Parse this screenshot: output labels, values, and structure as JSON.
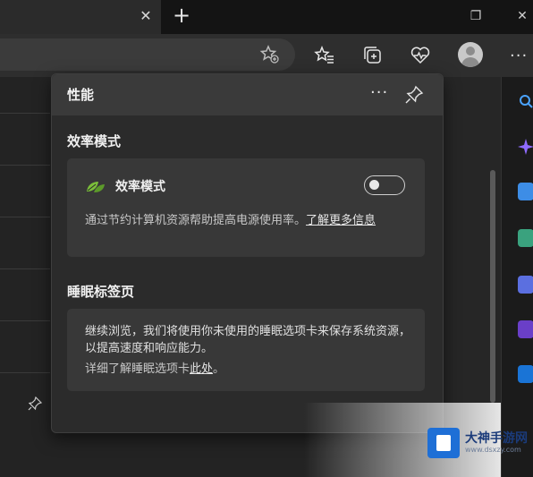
{
  "browser": {
    "tab_close_glyph": "✕",
    "new_tab_glyph": "+",
    "window_controls": {
      "minimize": "—",
      "restore": "❐",
      "close": "✕"
    },
    "toolbar_icons": [
      "favorite-add-icon",
      "favorites-icon",
      "collections-icon",
      "performance-icon",
      "profile-avatar",
      "more-icon"
    ],
    "more_glyph": "···"
  },
  "flyout": {
    "title": "性能",
    "more_glyph": "···",
    "efficiency_section_title": "效率模式",
    "efficiency_label": "效率模式",
    "efficiency_toggle_on": false,
    "efficiency_desc": "通过节约计算机资源帮助提高电源使用率。",
    "efficiency_link": "了解更多信息",
    "sleeping_section_title": "睡眠标签页",
    "sleeping_desc": "继续浏览，我们将使用你未使用的睡眠选项卡来保存系统资源，以提高速度和响应能力。",
    "sleeping_more_prefix": "详细了解睡眠选项卡",
    "sleeping_link": "此处",
    "sleeping_more_suffix": "。"
  },
  "watermark": {
    "name": "大神手游网",
    "url": "www.dsxzy.com"
  },
  "colors": {
    "accent_green": "#7bbf3a",
    "flyout_bg": "#2b2b2b",
    "card_bg": "#383838"
  }
}
